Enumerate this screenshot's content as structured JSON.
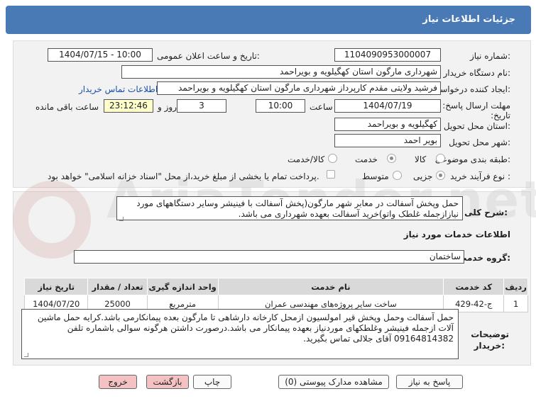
{
  "header": {
    "title": "جزئیات اطلاعات نیاز"
  },
  "fields": {
    "need_number_label": "شماره نیاز:",
    "need_number": "1104090953000007",
    "announce_label": "تاریخ و ساعت اعلان عمومی:",
    "announce_value": "1404/07/15 - 10:00",
    "buyer_label": "نام دستگاه خریدار:",
    "buyer_value": "شهرداری مارگون استان کهگیلویه و بویراحمد",
    "creator_label": "ایجاد کننده درخواست:",
    "creator_value": "فرشید  ولایتی مقدم  کارپرداز شهرداری مارگون استان کهگیلویه و بویراحمد",
    "contact_link": "اطلاعات تماس خریدار",
    "deadline_label": "مهلت ارسال پاسخ: تا تاریخ:",
    "deadline_date": "1404/07/19",
    "time_label": "ساعت",
    "deadline_time": "10:00",
    "days_value": "3",
    "days_label": "روز و",
    "remaining_time": "23:12:46",
    "remaining_label": "ساعت باقی مانده",
    "province_label": "استان محل تحویل:",
    "province_value": "کهگیلویه و بویراحمد",
    "city_label": "شهر محل تحویل:",
    "city_value": "بویر احمد",
    "category_label": "طبقه بندی موضوعی:",
    "category_options": [
      "کالا",
      "خدمت",
      "کالا/خدمت"
    ],
    "category_selected": "خدمت",
    "process_label": "نوع فرآیند خرید :",
    "process_options": [
      "جزیی",
      "متوسط"
    ],
    "process_selected": "جزیی",
    "payment_note": "پرداخت تمام یا بخشی از مبلغ خرید،از محل \"اسناد خزانه اسلامی\" خواهد بود."
  },
  "need": {
    "general_desc_label": "شرح کلی نیاز:",
    "general_desc": "حمل وپخش آسفالت در معابر شهر مارگون(پخش آسفالت با فینیشر وسایر دستگاههای مورد نیازازجمله غلطک واتو)خرید آسفالت بعهده شهرداری می باشد.",
    "services_info_title": "اطلاعات خدمات مورد نیاز",
    "service_group_label": "گروه خدمت:",
    "service_group_value": "ساختمان"
  },
  "table": {
    "headers": [
      "ردیف",
      "کد خدمت",
      "نام خدمت",
      "واحد اندازه گیری",
      "تعداد / مقدار",
      "تاریخ نیاز"
    ],
    "rows": [
      [
        "1",
        "ج-42-429",
        "ساخت سایر پروژه‌های مهندسی عمران",
        "مترمربع",
        "25000",
        "1404/07/20"
      ]
    ]
  },
  "buyer_notes": {
    "label_line1": "توضیحات",
    "label_line2": "خریدار:",
    "text": "حمل آسفالت وحمل وپخش قیر امولسیون ازمحل کارخانه دارشاهی تا مارگون بعده پیمانکارمی باشد.کرایه حمل ماشین آلات ازجمله فینیشر وغلطکهای موردنیاز بعهده پیمانکار می باشد.درصورت داشتن هرگونه سوالی باشماره تلفن 09164814382 آقای جلالی تماس بگیرید."
  },
  "buttons": {
    "reply": "پاسخ به نیاز",
    "attachments": "مشاهده مدارک پیوستی (0)",
    "print": "چاپ",
    "back": "بازگشت",
    "exit": "خروج"
  },
  "watermark": "AriaTender.net"
}
